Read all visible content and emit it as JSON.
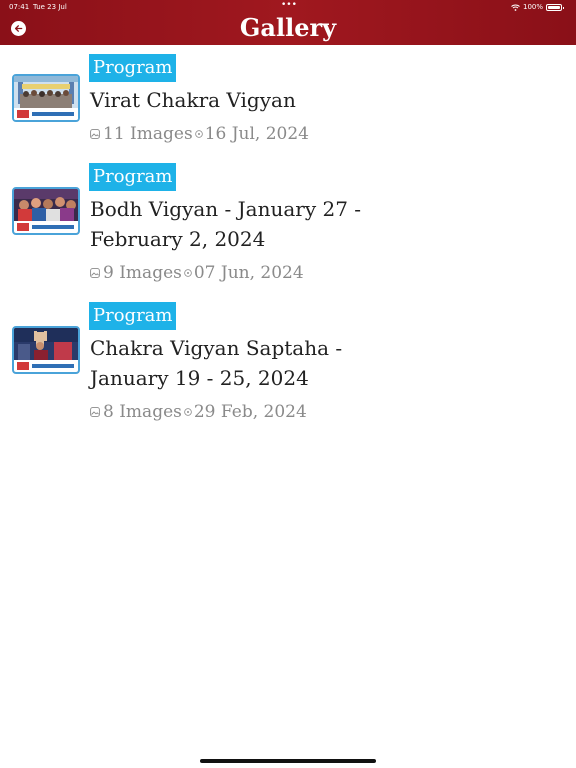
{
  "status_bar": {
    "time": "07:41",
    "date": "Tue 23 Jul",
    "dots": "•••",
    "battery": "100%"
  },
  "header": {
    "title": "Gallery",
    "background": "#9b151d"
  },
  "items": [
    {
      "tag": "Program",
      "title": "Virat Chakra Vigyan",
      "images": "11 Images",
      "date": "16 Jul, 2024"
    },
    {
      "tag": "Program",
      "title": "Bodh Vigyan - January 27 - February 2, 2024",
      "images": "9 Images",
      "date": "07 Jun, 2024"
    },
    {
      "tag": "Program",
      "title": "Chakra Vigyan Saptaha - January 19 - 25, 2024",
      "images": "8 Images",
      "date": "29 Feb, 2024"
    }
  ],
  "colors": {
    "accent": "#1eb2e8",
    "title_text": "#222222",
    "meta_text": "#8a8a8a"
  },
  "icons": {
    "back": "arrow-left-icon",
    "images": "image-icon",
    "date": "clock-icon"
  }
}
